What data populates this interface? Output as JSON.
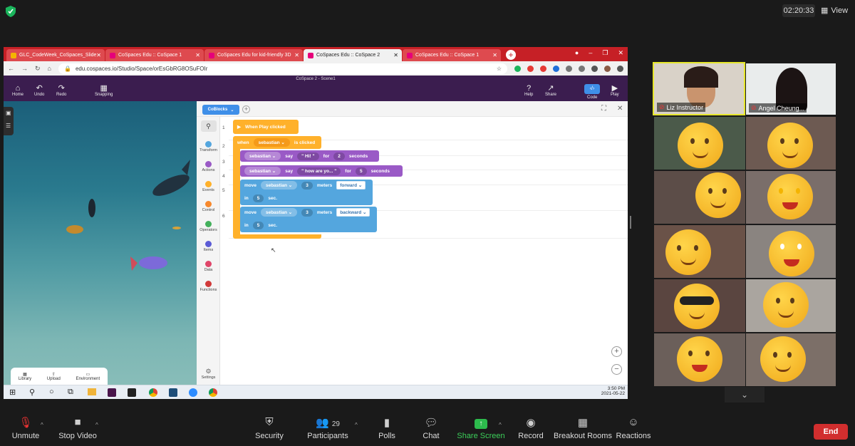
{
  "zoom": {
    "clock": "02:20:33",
    "view_label": "View",
    "toolbar": {
      "unmute": "Unmute",
      "stop_video": "Stop Video",
      "security": "Security",
      "participants": "Participants",
      "participants_count": "29",
      "polls": "Polls",
      "chat": "Chat",
      "share_screen": "Share Screen",
      "record": "Record",
      "breakout_rooms": "Breakout Rooms",
      "reactions": "Reactions",
      "end": "End"
    },
    "participants": [
      {
        "name": "Liz Instructor"
      },
      {
        "name": "Angel Cheung..."
      }
    ]
  },
  "browser": {
    "tabs": [
      {
        "label": "GLC_CodeWeek_CoSpaces_Slide"
      },
      {
        "label": "CoSpaces Edu :: CoSpace 1"
      },
      {
        "label": "CoSpaces Edu for kid-friendly 3D"
      },
      {
        "label": "CoSpaces Edu :: CoSpace 2"
      },
      {
        "label": "CoSpaces Edu :: CoSpace 1"
      }
    ],
    "url": "edu.cospaces.io/Studio/Space/orEsGbRG8OSuFOIr"
  },
  "cospaces": {
    "title": "CoSpace 2 - Scene1",
    "header": {
      "home": "Home",
      "undo": "Undo",
      "redo": "Redo",
      "snapping": "Snapping",
      "help": "Help",
      "share": "Share",
      "code": "Code",
      "play": "Play"
    },
    "scene_bottom": {
      "library": "Library",
      "upload": "Upload",
      "environment": "Environment"
    },
    "coblocks_tab": "CoBlocks",
    "categories": [
      "Transform",
      "Actions",
      "Events",
      "Control",
      "Operators",
      "Items",
      "Data",
      "Functions"
    ],
    "settings": "Settings",
    "line_numbers": [
      "1",
      "2",
      "3",
      "4",
      "5",
      "6"
    ],
    "blocks": {
      "when_play": "When Play clicked",
      "when": "when",
      "when_target": "sebastian",
      "is_clicked": "is clicked",
      "say1": {
        "target": "sebastian",
        "verb": "say",
        "text": "Hi!",
        "for": "for",
        "num": "2",
        "unit": "seconds"
      },
      "say2": {
        "target": "sebastian",
        "verb": "say",
        "text": "how are yo...",
        "for": "for",
        "num": "5",
        "unit": "seconds"
      },
      "move1": {
        "verb": "move",
        "target": "sebastian",
        "num": "3",
        "unit": "meters",
        "dir": "forward",
        "in": "in",
        "secs": "5",
        "sec": "sec."
      },
      "move2": {
        "verb": "move",
        "target": "sebastian",
        "num": "3",
        "unit": "meters",
        "dir": "backward",
        "in": "in",
        "secs": "5",
        "sec": "sec."
      }
    }
  },
  "taskbar": {
    "time": "3:50 PM",
    "date": "2021-05-22"
  }
}
